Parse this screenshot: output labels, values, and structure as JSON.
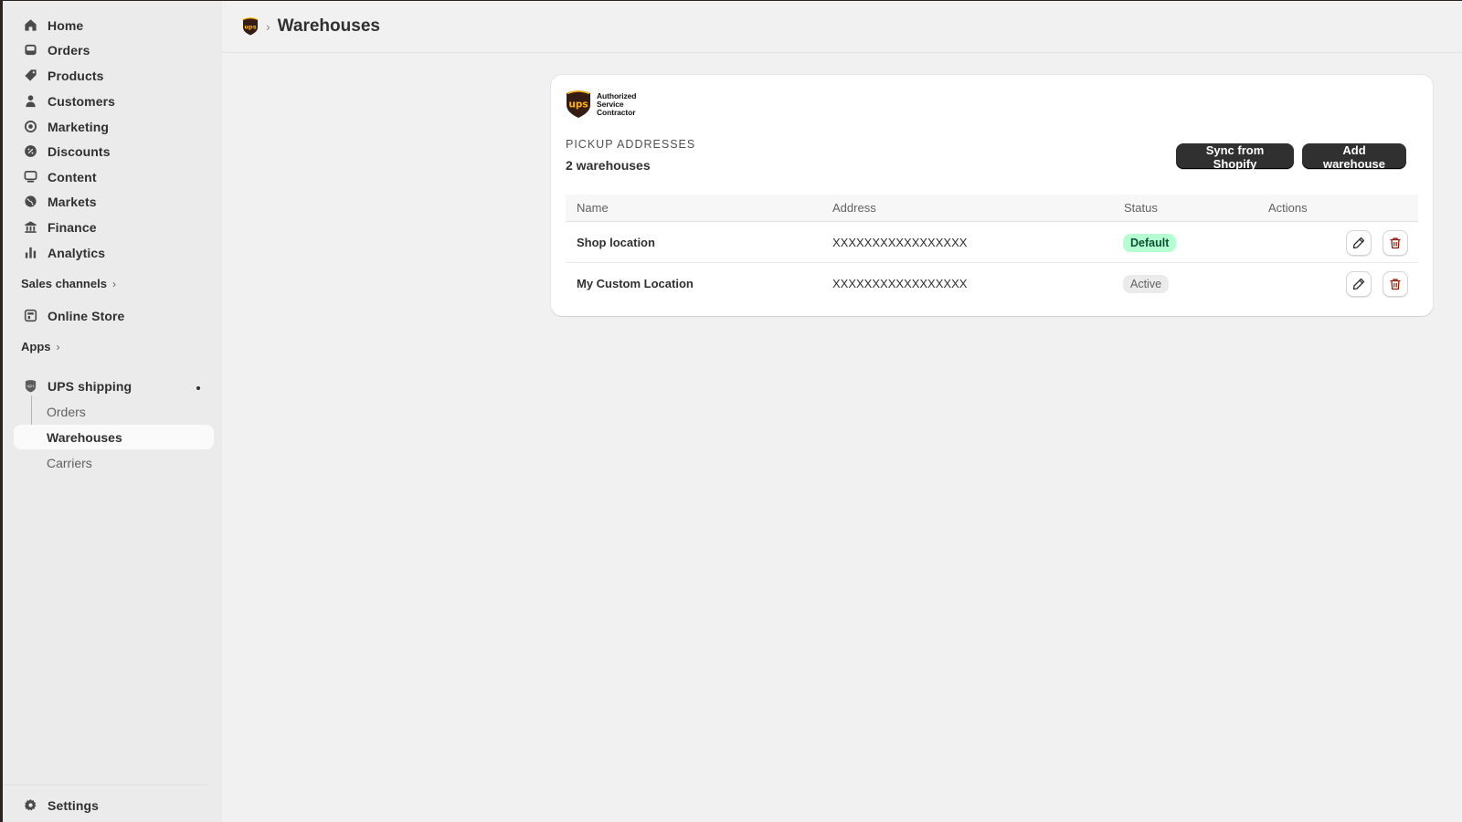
{
  "sidebar": {
    "nav": [
      {
        "label": "Home",
        "icon": "home-icon"
      },
      {
        "label": "Orders",
        "icon": "inbox-icon"
      },
      {
        "label": "Products",
        "icon": "tag-icon"
      },
      {
        "label": "Customers",
        "icon": "person-icon"
      },
      {
        "label": "Marketing",
        "icon": "target-icon"
      },
      {
        "label": "Discounts",
        "icon": "discount-icon"
      },
      {
        "label": "Content",
        "icon": "content-icon"
      },
      {
        "label": "Markets",
        "icon": "globe-icon"
      },
      {
        "label": "Finance",
        "icon": "bank-icon"
      },
      {
        "label": "Analytics",
        "icon": "bar-chart-icon"
      }
    ],
    "sales_channels_label": "Sales channels",
    "online_store_label": "Online Store",
    "apps_label": "Apps",
    "app": {
      "label": "UPS shipping",
      "sub_items": [
        "Orders",
        "Warehouses",
        "Carriers"
      ],
      "active_sub": "Warehouses"
    },
    "settings_label": "Settings"
  },
  "header": {
    "title": "Warehouses"
  },
  "card": {
    "brand_lines": [
      "Authorized",
      "Service",
      "Contractor"
    ],
    "logo_text": "ups",
    "eyebrow": "PICKUP ADDRESSES",
    "count": "2 warehouses",
    "sync_button": "Sync from Shopify",
    "add_button": "Add warehouse",
    "columns": [
      "Name",
      "Address",
      "Status",
      "Actions"
    ],
    "rows": [
      {
        "name": "Shop location",
        "address": "XXXXXXXXXXXXXXXXX",
        "status": "Default"
      },
      {
        "name": "My Custom Location",
        "address": "XXXXXXXXXXXXXXXXX",
        "status": "Active"
      }
    ]
  },
  "colors": {
    "ups_brown": "#351c15",
    "ups_gold": "#ffb500",
    "default_badge_bg": "#b4fed2",
    "delete_red": "#8e1f0b"
  }
}
